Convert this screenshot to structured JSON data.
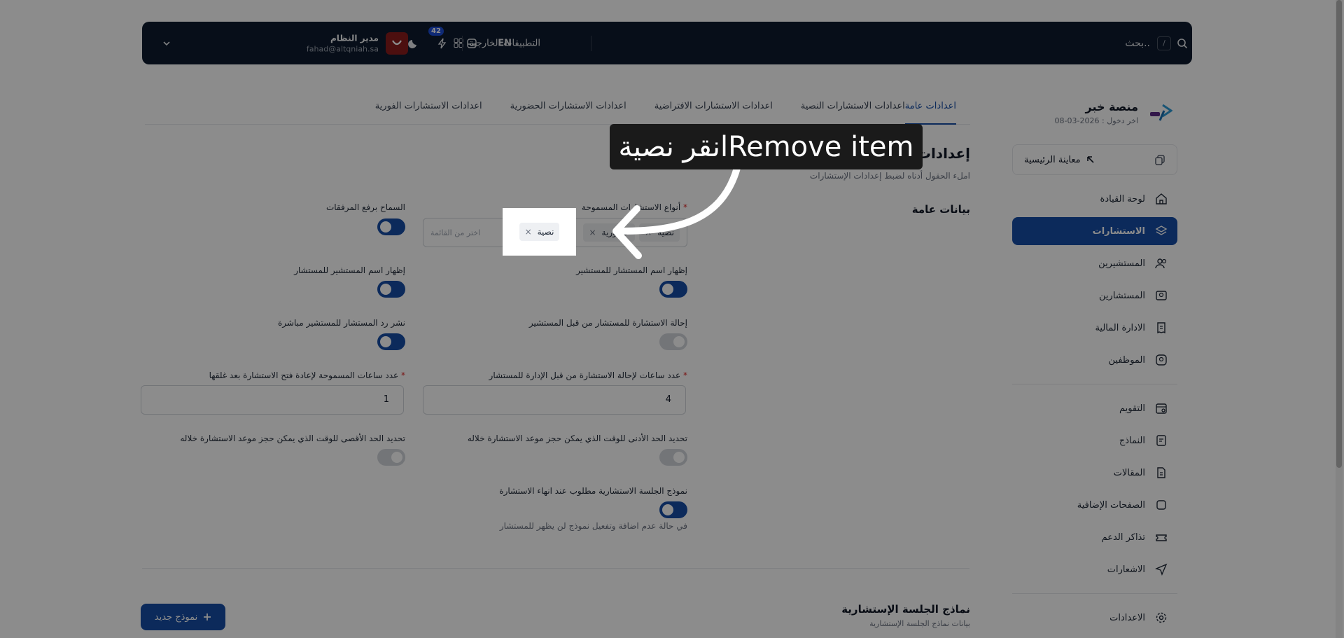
{
  "topbar": {
    "search_placeholder": "بحث..",
    "search_shortcut": "/",
    "external_apps": "التطبيقات الخارجية",
    "lang": "EN",
    "notification_count": "42",
    "user_name": "مدير النظام",
    "user_email": "fahad@altqniah.sa"
  },
  "sidebar": {
    "platform_name": "منصة خبر",
    "last_login": "اخر دخول : 2026-03-08",
    "preview_home": "معاينة الرئيسية",
    "items": [
      {
        "label": "لوحة القيادة"
      },
      {
        "label": "الاستشارات"
      },
      {
        "label": "المستشيرين"
      },
      {
        "label": "المستشارين"
      },
      {
        "label": "الادارة المالية"
      },
      {
        "label": "الموظفين"
      },
      {
        "label": "التقويم"
      },
      {
        "label": "النماذج"
      },
      {
        "label": "المقالات"
      },
      {
        "label": "الصفحات الإضافية"
      },
      {
        "label": "تذاكر الدعم"
      },
      {
        "label": "الاشعارات"
      },
      {
        "label": "الاعدادات"
      }
    ]
  },
  "tabs": [
    {
      "label": "اعدادات عامة"
    },
    {
      "label": "اعدادات الاستشارات النصية"
    },
    {
      "label": "اعدادات الاستشارات الافتراضية"
    },
    {
      "label": "اعدادات الاستشارات الحضورية"
    },
    {
      "label": "اعدادات الاستشارات الفورية"
    }
  ],
  "page": {
    "title": "إعدادات الاستشارات",
    "subtitle": "املء الحقول أدناه لضبط إعدادات الإستشارات",
    "section": "بيانات عامة"
  },
  "fields": {
    "allowed_types_label": "أنواع الاستشارات المسموحة",
    "allowed_types_chips": [
      "نصية",
      "حضورية"
    ],
    "allowed_types_placeholder": "اختر من القائمة",
    "allow_attachments": "السماح برفع المرفقات",
    "show_consultant_name": "إظهار اسم المستشار للمستشير",
    "show_client_name": "إظهار اسم المستشير للمستشار",
    "refer_by_client": "إحالة الاستشارة للمستشار من قبل المستشير",
    "publish_reply": "نشر رد المستشار للمستشير مباشرة",
    "refer_hours_label": "عدد ساعات لإحالة الاستشارة من قبل الإدارة للمستشار",
    "refer_hours_value": "4",
    "reopen_hours_label": "عدد ساعات المسموحة لإعادة فتح الاستشارة بعد غلقها",
    "reopen_hours_value": "1",
    "min_time_label": "تحديد الحد الأدنى للوقت الذي يمكن حجز موعد الاستشارة خلاله",
    "max_time_label": "تحديد الحد الأقصى للوقت الذي يمكن حجز موعد الاستشارة خلاله",
    "session_form_label": "نموذج الجلسة الاستشارية مطلوب عند انهاء الاستشارة",
    "session_form_help": "في حالة عدم اضافة وتفعيل نموذج لن يظهر للمستشار"
  },
  "forms_section": {
    "title": "نماذج الجلسة الإستشارية",
    "subtitle": "بيانات نماذج الجلسة الإستشارية",
    "new_button": "نموذج جديد"
  },
  "overlay": {
    "callout": "انقر نصيةRemove item",
    "chip_label": "نصية"
  },
  "colors": {
    "primary": "#174ea6",
    "topbar": "#0d1b2e",
    "avatar": "#8b1d1d"
  }
}
